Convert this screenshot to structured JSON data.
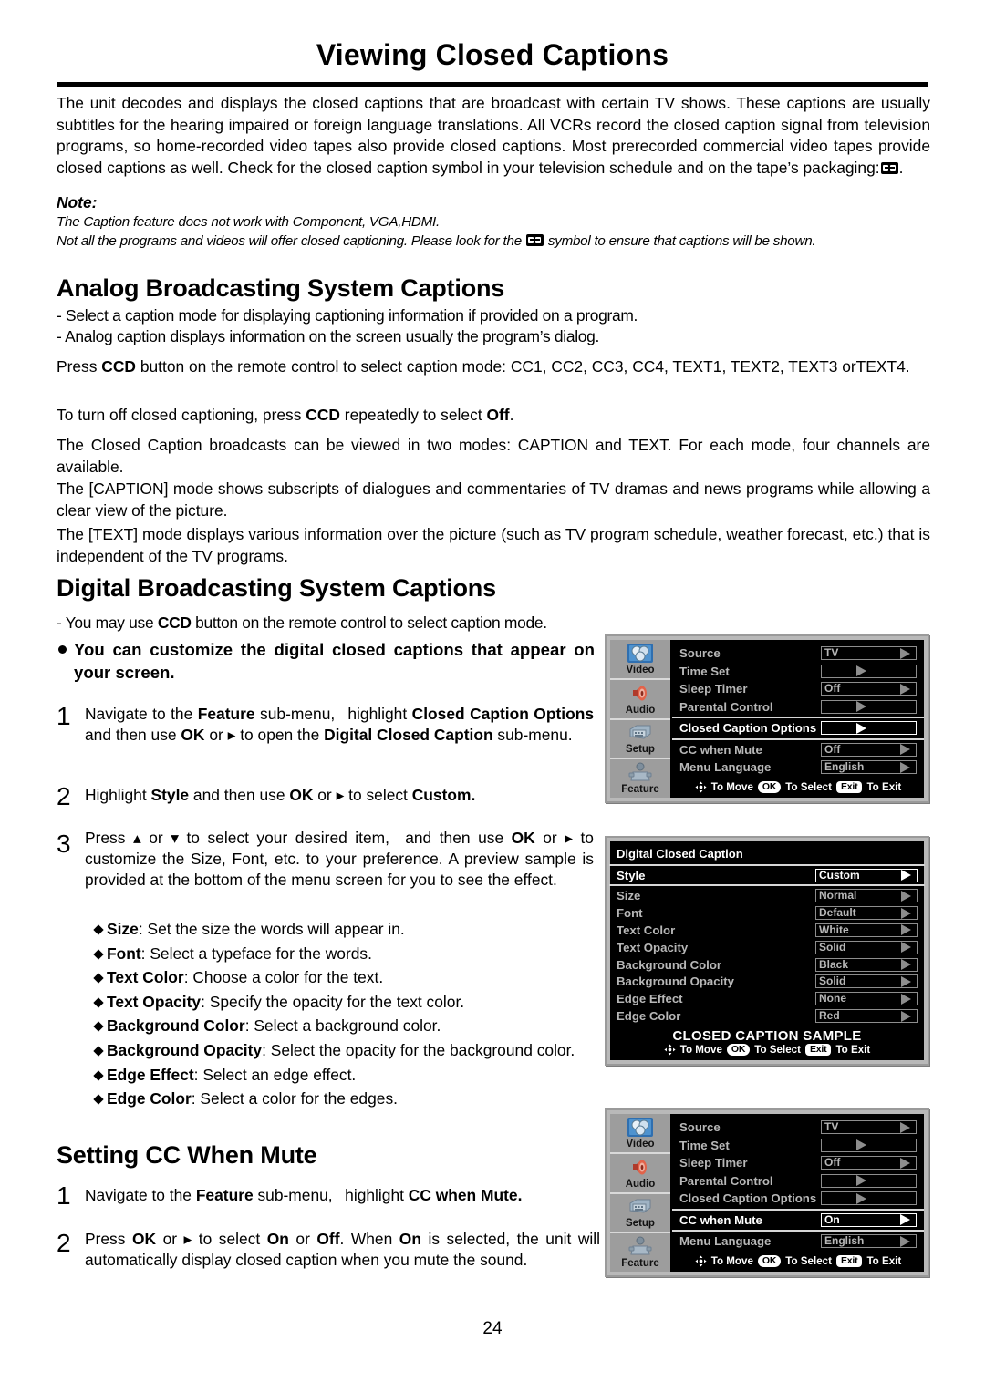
{
  "document": {
    "title": "Viewing Closed Captions",
    "page_number": "24",
    "intro_paragraph": "The unit decodes and displays the closed captions that are broadcast with certain TV shows. These captions are usually subtitles for the hearing impaired or foreign language translations. All VCRs record the closed caption signal from television programs, so home-recorded video tapes also provide closed captions. Most prerecorded commercial video tapes provide closed captions as well. Check for the closed caption symbol in your television schedule and on the tape’s packaging:",
    "intro_tail": ".",
    "note": {
      "label": "Note:",
      "line1": "The Caption feature does not work with Component, VGA,HDMI.",
      "line2_before": "Not all the programs and videos will offer closed captioning. Please look for the",
      "line2_after": "symbol to ensure that captions will be shown."
    }
  },
  "analog": {
    "heading": "Analog Broadcasting System Captions",
    "dash1": "- Select a caption mode for displaying captioning information if provided on a program.",
    "dash2": "- Analog caption displays information on the screen usually the program’s dialog.",
    "p1_a": "Press ",
    "p1_b": "CCD",
    "p1_c": " button on the remote control to select caption mode: CC1, CC2, CC3, CC4, TEXT1, TEXT2, TEXT3 orTEXT4.",
    "p2_a": "To turn off closed captioning, press ",
    "p2_b": "CCD",
    "p2_c": " repeatedly to select ",
    "p2_d": "Off",
    "p2_e": ".",
    "p3": "The Closed Caption broadcasts can be viewed in two modes: CAPTION and TEXT. For each mode, four channels are available.",
    "p4": "The [CAPTION] mode shows subscripts of dialogues and commentaries of TV dramas and news programs while allowing a clear view of the picture.",
    "p5": "The [TEXT] mode displays various information over the picture (such as TV program schedule, weather forecast, etc.) that is independent of the TV programs."
  },
  "digital": {
    "heading": "Digital Broadcasting System Captions",
    "dash1_a": "- You may use ",
    "dash1_b": "CCD",
    "dash1_c": " button on the remote control to select caption mode.",
    "bullet": "You can customize the digital closed captions that appear on your screen.",
    "steps": [
      {
        "num": "1",
        "parts": [
          {
            "t": "Navigate to the ",
            "b": false
          },
          {
            "t": "Feature",
            "b": true
          },
          {
            "t": " sub-menu,  highlight ",
            "b": false
          },
          {
            "t": "Closed Caption Options",
            "b": true
          },
          {
            "t": " and then use ",
            "b": false
          },
          {
            "t": "OK",
            "b": true
          },
          {
            "t": " or ",
            "b": false
          },
          {
            "t": "▸",
            "b": false
          },
          {
            "t": " to open the ",
            "b": false
          },
          {
            "t": "Digital Closed Caption",
            "b": true
          },
          {
            "t": " sub-menu.",
            "b": false
          }
        ]
      },
      {
        "num": "2",
        "parts": [
          {
            "t": "Highlight ",
            "b": false
          },
          {
            "t": "Style",
            "b": true
          },
          {
            "t": " and then use ",
            "b": false
          },
          {
            "t": "OK",
            "b": true
          },
          {
            "t": " or ",
            "b": false
          },
          {
            "t": "▸",
            "b": false
          },
          {
            "t": " to select ",
            "b": false
          },
          {
            "t": "Custom.",
            "b": true
          }
        ]
      },
      {
        "num": "3",
        "parts": [
          {
            "t": "Press ",
            "b": false
          },
          {
            "t": "▴",
            "b": false
          },
          {
            "t": " or ",
            "b": false
          },
          {
            "t": "▾",
            "b": false
          },
          {
            "t": " to select your desired item,  and then use ",
            "b": false
          },
          {
            "t": "OK",
            "b": true
          },
          {
            "t": " or ",
            "b": false
          },
          {
            "t": "▸",
            "b": false
          },
          {
            "t": " to customize the Size, Font, etc. to your preference. A preview sample is provided at the bottom of the menu  screen for you to see the effect.",
            "b": false
          }
        ]
      }
    ],
    "options": [
      {
        "term": "Size",
        "desc": ": Set the size the words will appear in."
      },
      {
        "term": "Font",
        "desc": ": Select a typeface for the words."
      },
      {
        "term": "Text Color",
        "desc": ": Choose a color for the text."
      },
      {
        "term": "Text Opacity",
        "desc": ": Specify the opacity for the text color."
      },
      {
        "term": "Background Color",
        "desc": ": Select a background color."
      },
      {
        "term": "Background Opacity",
        "desc": ": Select the opacity for the background color."
      },
      {
        "term": "Edge Effect",
        "desc": ": Select an edge effect."
      },
      {
        "term": "Edge Color",
        "desc": ": Select a color for the edges."
      }
    ]
  },
  "mute_section": {
    "heading": "Setting CC When Mute",
    "steps": [
      {
        "num": "1",
        "parts": [
          {
            "t": "Navigate to the ",
            "b": false
          },
          {
            "t": "Feature",
            "b": true
          },
          {
            "t": " sub-menu,  highlight ",
            "b": false
          },
          {
            "t": "CC when Mute.",
            "b": true
          }
        ]
      },
      {
        "num": "2",
        "parts": [
          {
            "t": "Press  ",
            "b": false
          },
          {
            "t": "OK",
            "b": true
          },
          {
            "t": " or ",
            "b": false
          },
          {
            "t": "▸",
            "b": false
          },
          {
            "t": " to select ",
            "b": false
          },
          {
            "t": "On",
            "b": true
          },
          {
            "t": " or ",
            "b": false
          },
          {
            "t": "Off",
            "b": true
          },
          {
            "t": ".",
            "b": false
          },
          {
            "t": "\nWhen ",
            "b": false
          },
          {
            "t": "On",
            "b": true
          },
          {
            "t": " is selected, the unit will automatically display closed caption when you mute the sound.",
            "b": false
          }
        ]
      }
    ]
  },
  "osd_menu_1": {
    "sidebar": [
      {
        "label": "Video",
        "icon": "video-icon"
      },
      {
        "label": "Audio",
        "icon": "speaker-icon"
      },
      {
        "label": "Setup",
        "icon": "setup-icon"
      },
      {
        "label": "Feature",
        "icon": "feature-icon"
      }
    ],
    "rows": [
      {
        "label": "Source",
        "value": "TV",
        "selected": false,
        "centertri": false
      },
      {
        "label": "Time Set",
        "value": "",
        "selected": false,
        "centertri": true
      },
      {
        "label": "Sleep Timer",
        "value": "Off",
        "selected": false,
        "centertri": false
      },
      {
        "label": "Parental Control",
        "value": "",
        "selected": false,
        "centertri": true
      },
      {
        "label": "Closed Caption Options",
        "value": "",
        "selected": true,
        "centertri": true
      },
      {
        "label": "CC when Mute",
        "value": "Off",
        "selected": false,
        "centertri": false
      },
      {
        "label": "Menu Language",
        "value": "English",
        "selected": false,
        "centertri": false
      }
    ],
    "footer": {
      "move": "To Move",
      "ok": "OK",
      "select": "To Select",
      "exit": "Exit",
      "exit_label": "To Exit"
    }
  },
  "osd_menu_2": {
    "title": "Digital Closed Caption",
    "rows": [
      {
        "label": "Style",
        "value": "Custom",
        "selected": true
      },
      {
        "label": "Size",
        "value": "Normal",
        "selected": false
      },
      {
        "label": "Font",
        "value": "Default",
        "selected": false
      },
      {
        "label": "Text Color",
        "value": "White",
        "selected": false
      },
      {
        "label": "Text Opacity",
        "value": "Solid",
        "selected": false
      },
      {
        "label": "Background Color",
        "value": "Black",
        "selected": false
      },
      {
        "label": "Background Opacity",
        "value": "Solid",
        "selected": false
      },
      {
        "label": "Edge Effect",
        "value": "None",
        "selected": false
      },
      {
        "label": "Edge Color",
        "value": "Red",
        "selected": false
      }
    ],
    "sample_text": "CLOSED CAPTION SAMPLE",
    "footer": {
      "move": "To Move",
      "ok": "OK",
      "select": "To Select",
      "exit": "Exit",
      "exit_label": "To Exit"
    }
  },
  "osd_menu_3": {
    "sidebar": [
      {
        "label": "Video",
        "icon": "video-icon"
      },
      {
        "label": "Audio",
        "icon": "speaker-icon"
      },
      {
        "label": "Setup",
        "icon": "setup-icon"
      },
      {
        "label": "Feature",
        "icon": "feature-icon"
      }
    ],
    "rows": [
      {
        "label": "Source",
        "value": "TV",
        "selected": false,
        "centertri": false
      },
      {
        "label": "Time Set",
        "value": "",
        "selected": false,
        "centertri": true
      },
      {
        "label": "Sleep Timer",
        "value": "Off",
        "selected": false,
        "centertri": false
      },
      {
        "label": "Parental Control",
        "value": "",
        "selected": false,
        "centertri": true
      },
      {
        "label": "Closed Caption Options",
        "value": "",
        "selected": false,
        "centertri": true
      },
      {
        "label": "CC when Mute",
        "value": "On",
        "selected": true,
        "centertri": false
      },
      {
        "label": "Menu Language",
        "value": "English",
        "selected": false,
        "centertri": false
      }
    ],
    "footer": {
      "move": "To Move",
      "ok": "OK",
      "select": "To Select",
      "exit": "Exit",
      "exit_label": "To Exit"
    }
  },
  "colors": {
    "osd_frame": "#b9b9b9",
    "osd_background": "#000000",
    "osd_text": "#b7b7b7",
    "osd_text_selected": "#ffffff",
    "sidebar_background": "#9d9d9d"
  }
}
